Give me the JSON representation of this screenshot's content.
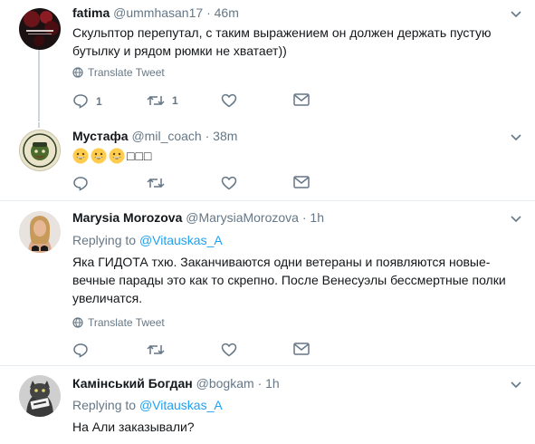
{
  "tweets": [
    {
      "name": "fatima",
      "handle": "@ummhasan17",
      "dot": "·",
      "time": "46m",
      "text": "Скульптор перепутал, с таким выражением он должен держать пустую бутылку и рядом рюмки не хватает))",
      "translate": "Translate Tweet",
      "reply_count": "1",
      "retweet_count": "1",
      "like_count": ""
    },
    {
      "name": "Мустафа",
      "handle": "@mil_coach",
      "dot": "·",
      "time": "38m",
      "boxes": "□□□"
    },
    {
      "name": "Marysia Morozova",
      "handle": "@MarysiaMorozova",
      "dot": "·",
      "time": "1h",
      "replying_label": "Replying to",
      "replying_mention": "@Vitauskas_A",
      "text": "Яка ГИДОТА тхю. Заканчиваются одни ветераны и появляются новые- вечные парады это как то скрепно. После Венесуэлы бессмертные полки увеличатся.",
      "translate": "Translate Tweet"
    },
    {
      "name": "Камінський Богдан",
      "handle": "@bogkam",
      "dot": "·",
      "time": "1h",
      "replying_label": "Replying to",
      "replying_mention": "@Vitauskas_A",
      "text": "На Али заказывали?"
    }
  ],
  "colors": {
    "accent": "#1da1f2",
    "muted": "#657786",
    "border": "#e6ecf0"
  }
}
